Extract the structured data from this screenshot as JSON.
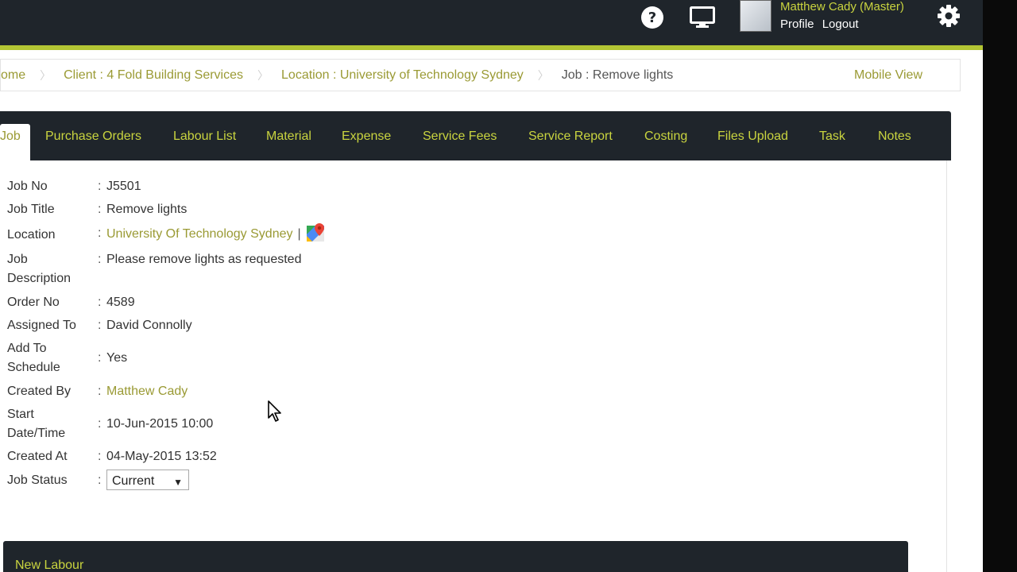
{
  "header": {
    "user_name": "Matthew Cady (Master)",
    "profile_label": "Profile",
    "logout_label": "Logout",
    "icons": [
      "help-icon",
      "monitor-icon",
      "gear-icon"
    ]
  },
  "breadcrumb": {
    "items": [
      "ome",
      "Client : 4 Fold Building Services",
      "Location : University of Technology Sydney",
      "Job : Remove lights"
    ],
    "mobile_view": "Mobile View"
  },
  "tabs": [
    "Job",
    "Purchase Orders",
    "Labour List",
    "Material",
    "Expense",
    "Service Fees",
    "Service Report",
    "Costing",
    "Files Upload",
    "Task",
    "Notes"
  ],
  "details": {
    "job_no": {
      "label": "Job No",
      "value": "J5501"
    },
    "job_title": {
      "label": "Job Title",
      "value": "Remove lights"
    },
    "location": {
      "label": "Location",
      "value": "University Of Technology Sydney",
      "separator": "|"
    },
    "job_description": {
      "label_line1": "Job",
      "label_line2": "Description",
      "value": "Please remove lights as requested"
    },
    "order_no": {
      "label": "Order No",
      "value": "4589"
    },
    "assigned_to": {
      "label": "Assigned To",
      "value": "David Connolly"
    },
    "add_to_schedule": {
      "label_line1": "Add To",
      "label_line2": "Schedule",
      "value": "Yes"
    },
    "created_by": {
      "label": "Created By",
      "value": "Matthew Cady"
    },
    "start_datetime": {
      "label_line1": "Start",
      "label_line2": "Date/Time",
      "value": "10-Jun-2015 10:00"
    },
    "created_at": {
      "label": "Created At",
      "value": "04-May-2015 13:52"
    },
    "job_status": {
      "label": "Job Status",
      "value": "Current"
    },
    "colon": ":"
  },
  "labour_panel": {
    "title": "New Labour"
  },
  "colors": {
    "accent": "#c9d43f",
    "link": "#9a9a34",
    "dark": "#1f252b"
  }
}
